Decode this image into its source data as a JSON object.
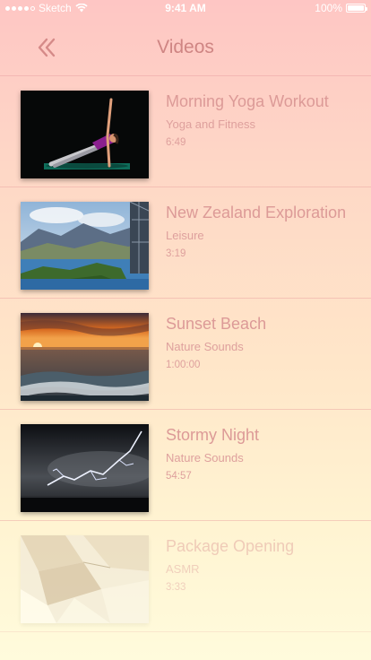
{
  "status_bar": {
    "carrier": "Sketch",
    "time": "9:41 AM",
    "battery_percent": "100%",
    "battery_level": 1.0,
    "signal_bars": 4
  },
  "nav": {
    "back_icon": "double-chevron-left-icon",
    "title": "Videos"
  },
  "videos": [
    {
      "title": "Morning Yoga Workout",
      "category": "Yoga and Fitness",
      "duration": "6:49"
    },
    {
      "title": "New Zealand Exploration",
      "category": "Leisure",
      "duration": "3:19"
    },
    {
      "title": "Sunset Beach",
      "category": "Nature Sounds",
      "duration": "1:00:00"
    },
    {
      "title": "Stormy Night",
      "category": "Nature Sounds",
      "duration": "54:57"
    },
    {
      "title": "Package Opening",
      "category": "ASMR",
      "duration": "3:33"
    }
  ],
  "colors": {
    "gradient_top": "#fec6c4",
    "gradient_bottom": "#fffbdc",
    "text_accent": "#dc9a97"
  }
}
